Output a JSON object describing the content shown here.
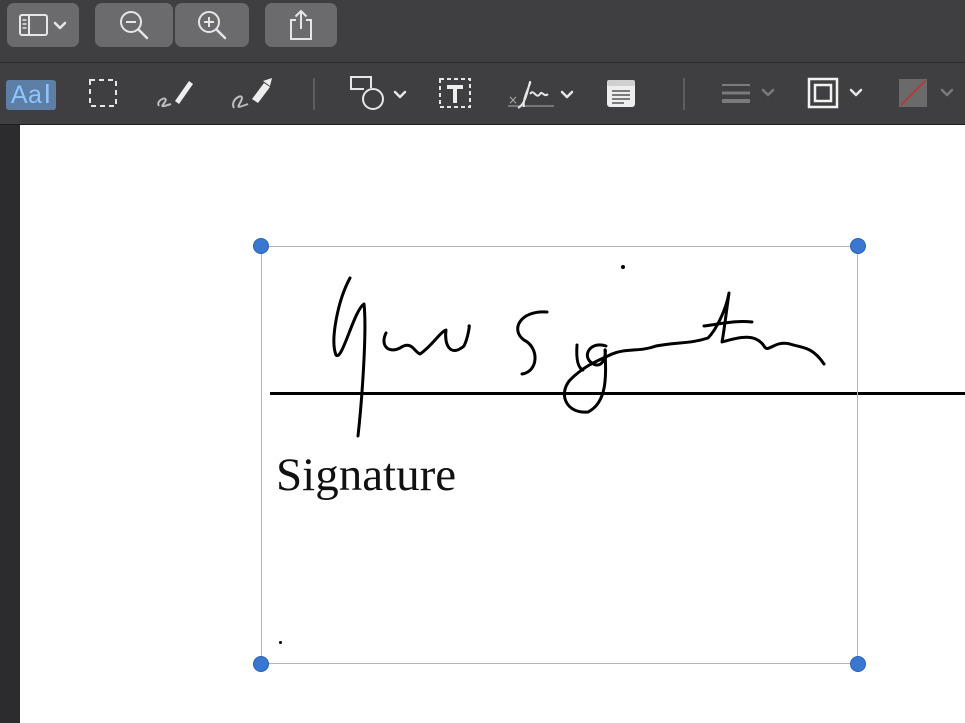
{
  "toolbar": {
    "sidebar_toggle_icon": "sidebar-icon",
    "zoom_out_icon": "zoom-out-icon",
    "zoom_in_icon": "zoom-in-icon",
    "share_icon": "share-icon"
  },
  "markup_toolbar": {
    "text_selection_label": "Aa",
    "tools": [
      "text-selection",
      "rectangular-selection",
      "sketch",
      "draw",
      "shapes",
      "text-box",
      "sign",
      "note",
      "shape-style",
      "border-color",
      "fill-color"
    ]
  },
  "document": {
    "signature_label": "Signature",
    "handwritten_signature": "Your Signature"
  },
  "colors": {
    "toolbar_bg": "#3f3f41",
    "button_bg": "#6b6b6d",
    "icon": "#dcdcdc",
    "accent_text_bg": "#5d7fa6",
    "handle": "#3a77d0"
  }
}
